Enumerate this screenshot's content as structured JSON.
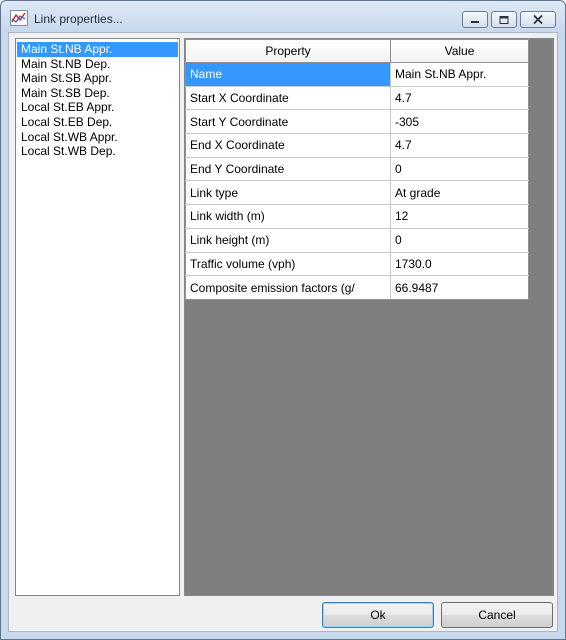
{
  "window": {
    "title": "Link properties...",
    "app_icon": "chart-link-icon",
    "buttons": {
      "minimize": "minimize-icon",
      "maximize": "maximize-icon",
      "close": "close-icon"
    }
  },
  "links": {
    "selected_index": 0,
    "items": [
      "Main St.NB Appr.",
      "Main St.NB Dep.",
      "Main St.SB Appr.",
      "Main St.SB Dep.",
      "Local St.EB Appr.",
      "Local St.EB Dep.",
      "Local St.WB Appr.",
      "Local St.WB Dep."
    ]
  },
  "grid": {
    "headers": {
      "property": "Property",
      "value": "Value"
    },
    "selected_row": 0,
    "rows": [
      {
        "property": "Name",
        "value": "Main St.NB Appr."
      },
      {
        "property": "Start X Coordinate",
        "value": "4.7"
      },
      {
        "property": "Start Y Coordinate",
        "value": "-305"
      },
      {
        "property": "End X Coordinate",
        "value": "4.7"
      },
      {
        "property": "End Y Coordinate",
        "value": "0"
      },
      {
        "property": "Link type",
        "value": "At grade"
      },
      {
        "property": "Link width (m)",
        "value": "12"
      },
      {
        "property": "Link height (m)",
        "value": "0"
      },
      {
        "property": "Traffic volume (vph)",
        "value": "1730.0"
      },
      {
        "property": "Composite emission factors (g/",
        "value": "66.9487"
      }
    ]
  },
  "actions": {
    "ok_label": "Ok",
    "cancel_label": "Cancel"
  },
  "colors": {
    "selection": "#3399ff",
    "grid_background": "#7f7f7f"
  }
}
